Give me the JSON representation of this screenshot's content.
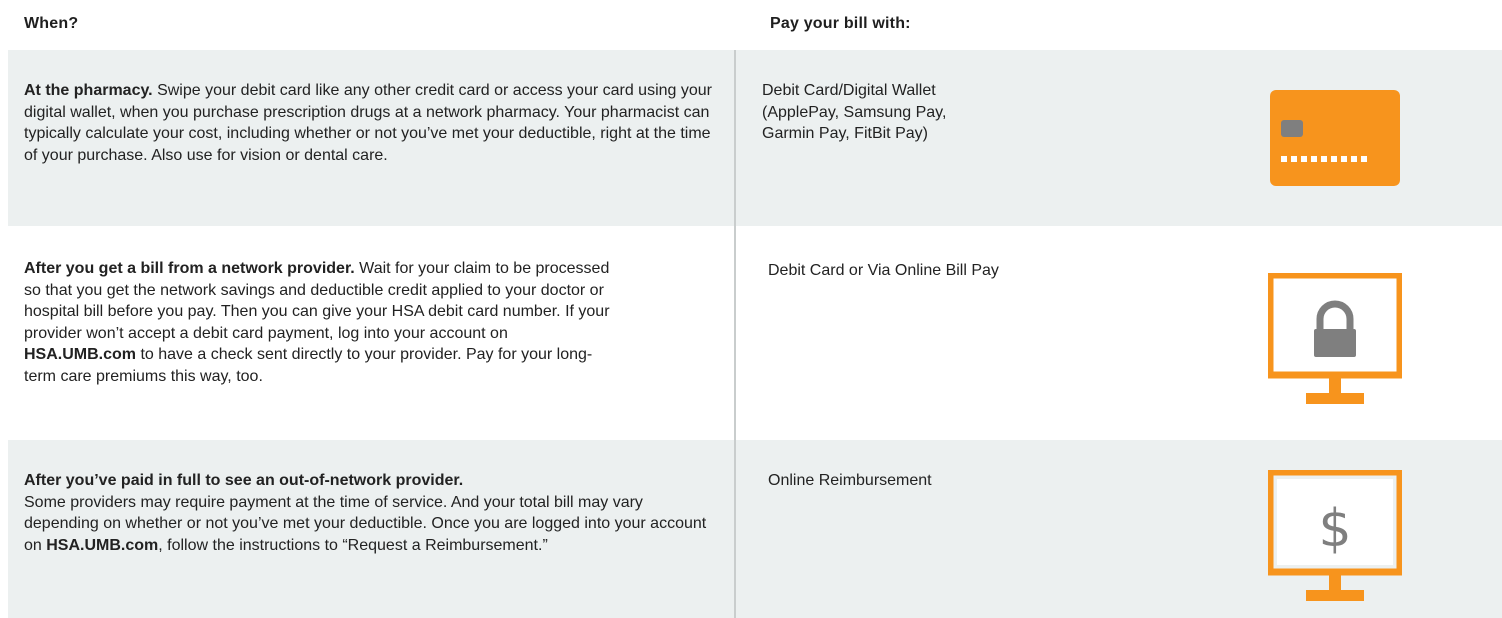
{
  "header": {
    "when_label": "When?",
    "pay_label": "Pay your bill with:"
  },
  "rows": [
    {
      "title": "At the pharmacy.",
      "body": " Swipe your debit card like any other credit card or access your card using your digital wallet, when you purchase prescription drugs at a network pharmacy. Your pharmacist can typically calculate your cost, including whether or not you’ve met your deductible, right at the time of your purchase. Also use for vision or dental care.",
      "pay_lines": [
        "Debit Card/Digital Wallet",
        "(ApplePay, Samsung Pay,",
        "Garmin Pay, FitBit Pay)"
      ],
      "icon": "credit-card-icon"
    },
    {
      "title": "After you get a bill from a network provider.",
      "body_part1": " Wait for your claim to be processed so that you get the network savings and deductible credit applied to your doctor or hospital bill before you pay. Then you can give your HSA debit card number. If your provider won’t accept a debit card payment, log into your account on ",
      "link": "HSA.UMB.com",
      "body_part2": " to have a check sent directly to your provider. Pay for your long-term care premiums this way, too.",
      "pay_lines": [
        "Debit Card or Via Online Bill Pay"
      ],
      "icon": "monitor-lock-icon"
    },
    {
      "title": "After you’ve paid in full to see an out-of-network provider.",
      "body_part1": "Some providers may require payment at the time of service. And your total bill may vary depending on whether or not you’ve met your deductible. Once you are logged into your account on ",
      "link": "HSA.UMB.com",
      "body_part2": ", follow the instructions to “Request a Reimbursement.”",
      "pay_lines": [
        "Online Reimbursement"
      ],
      "icon": "monitor-dollar-icon",
      "icon_glyph": "$"
    }
  ],
  "colors": {
    "accent": "#f7941d",
    "icon_gray": "#7f7f7f",
    "row_shade": "#ecf0f0",
    "divider": "#c9cdcd"
  }
}
